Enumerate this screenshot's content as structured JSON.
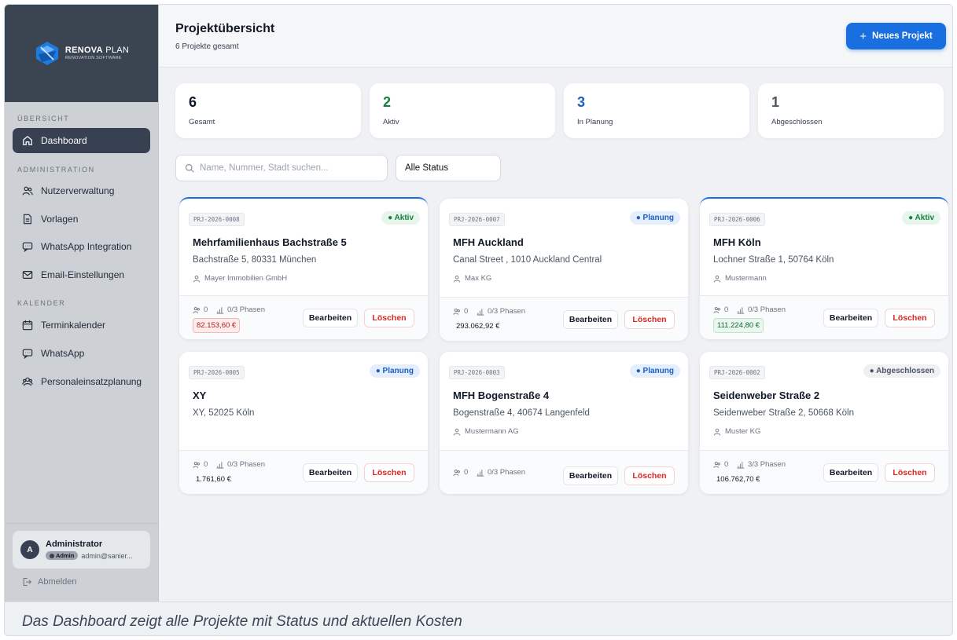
{
  "brand": {
    "title_bold": "RENOVA",
    "title_light": " PLAN",
    "subtitle": "RENOVATION SOFTWARE"
  },
  "sidebar": {
    "sections": [
      "ÜBERSICHT",
      "ADMINISTRATION",
      "KALENDER"
    ],
    "items": [
      {
        "label": "Dashboard",
        "icon": "home-icon",
        "active": true
      },
      {
        "label": "Nutzerverwaltung",
        "icon": "users-icon"
      },
      {
        "label": "Vorlagen",
        "icon": "file-icon"
      },
      {
        "label": "WhatsApp Integration",
        "icon": "chat-icon"
      },
      {
        "label": "Email-Einstellungen",
        "icon": "mail-icon"
      },
      {
        "label": "Terminkalender",
        "icon": "calendar-icon"
      },
      {
        "label": "WhatsApp",
        "icon": "chat-icon"
      },
      {
        "label": "Personaleinsatzplanung",
        "icon": "staff-icon"
      }
    ],
    "user": {
      "initial": "A",
      "name": "Administrator",
      "role": "Admin",
      "email": "admin@sanier..."
    },
    "logout_label": "Abmelden"
  },
  "header": {
    "title": "Projektübersicht",
    "subtitle": "6 Projekte gesamt",
    "new_button": "Neues Projekt"
  },
  "stats": [
    {
      "value": "6",
      "label": "Gesamt",
      "color": "#111827"
    },
    {
      "value": "2",
      "label": "Aktiv",
      "color": "#16803c"
    },
    {
      "value": "3",
      "label": "In Planung",
      "color": "#1a5fc4"
    },
    {
      "value": "1",
      "label": "Abgeschlossen",
      "color": "#4b5563"
    }
  ],
  "filters": {
    "search_placeholder": "Name, Nummer, Stadt suchen...",
    "status_value": "Alle Status"
  },
  "projects": [
    {
      "code": "PRJ-2026-0008",
      "status": "Aktiv",
      "title": "Mehrfamilienhaus Bachstraße 5",
      "address": "Bachstraße 5, 80331 München",
      "client": "Mayer Immobilien GmbH",
      "people": "0",
      "phases": "0/3 Phasen",
      "cost": "82.153,60 €"
    },
    {
      "code": "PRJ-2026-0007",
      "status": "Planung",
      "title": "MFH Auckland",
      "address": "Canal Street , 1010 Auckland Central",
      "client": "Max KG",
      "people": "0",
      "phases": "0/3 Phasen",
      "cost": "293.062,92 €"
    },
    {
      "code": "PRJ-2026-0006",
      "status": "Aktiv",
      "title": "MFH Köln",
      "address": "Lochner Straße 1, 50764 Köln",
      "client": "Mustermann",
      "people": "0",
      "phases": "0/3 Phasen",
      "cost": "111.224,80 €"
    },
    {
      "code": "PRJ-2026-0005",
      "status": "Planung",
      "title": "XY",
      "address": "XY, 52025 Köln",
      "client": "",
      "people": "0",
      "phases": "0/3 Phasen",
      "cost": "1.761,60 €"
    },
    {
      "code": "PRJ-2026-0003",
      "status": "Planung",
      "title": "MFH Bogenstraße 4",
      "address": "Bogenstraße 4, 40674 Langenfeld",
      "client": "Mustermann AG",
      "people": "0",
      "phases": "0/3 Phasen",
      "cost": ""
    },
    {
      "code": "PRJ-2026-0002",
      "status": "Abgeschlossen",
      "title": "Seidenweber Straße 2",
      "address": "Seidenweber Straße 2, 50668 Köln",
      "client": "Muster KG",
      "people": "0",
      "phases": "3/3 Phasen",
      "cost": "106.762,70 €"
    }
  ],
  "card_actions": {
    "edit": "Bearbeiten",
    "delete": "Löschen"
  },
  "caption": "Das Dashboard zeigt alle Projekte mit Status und aktuellen Kosten"
}
